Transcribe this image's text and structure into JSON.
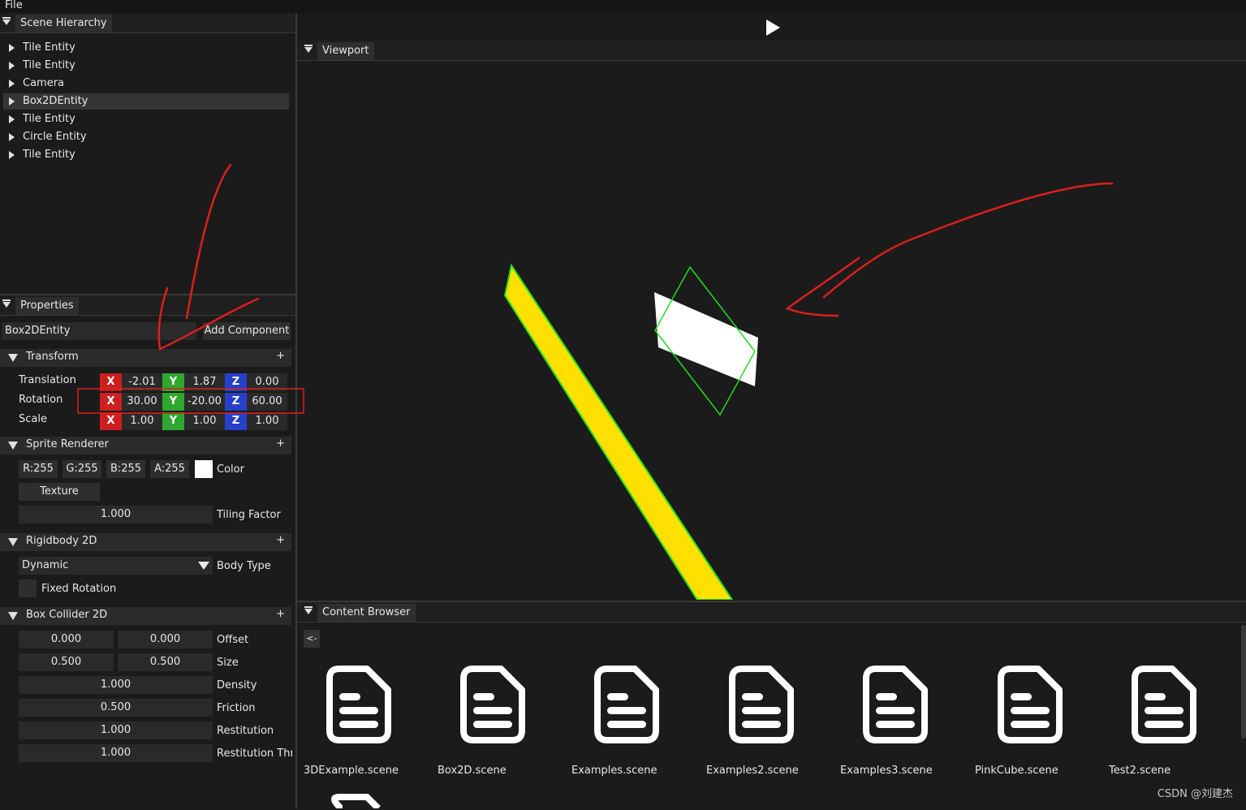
{
  "menu": {
    "file": "File"
  },
  "hierarchy": {
    "tab": "Scene Hierarchy",
    "items": [
      {
        "label": "Tile Entity"
      },
      {
        "label": "Tile Entity"
      },
      {
        "label": "Camera"
      },
      {
        "label": "Box2DEntity",
        "selected": true
      },
      {
        "label": "Tile Entity"
      },
      {
        "label": "Circle Entity"
      },
      {
        "label": "Tile Entity"
      }
    ]
  },
  "properties": {
    "tab": "Properties",
    "entity_name": "Box2DEntity",
    "add_component": "Add Component",
    "transform": {
      "title": "Transform",
      "plus": "+",
      "translation_label": "Translation",
      "rotation_label": "Rotation",
      "scale_label": "Scale",
      "axis_x": "X",
      "axis_y": "Y",
      "axis_z": "Z",
      "translation": [
        "-2.01",
        "1.87",
        "0.00"
      ],
      "rotation": [
        "30.00",
        "-20.00",
        "60.00"
      ],
      "scale": [
        "1.00",
        "1.00",
        "1.00"
      ]
    },
    "sprite": {
      "title": "Sprite Renderer",
      "plus": "+",
      "r": "R:255",
      "g": "G:255",
      "b": "B:255",
      "a": "A:255",
      "color_label": "Color",
      "color_value": "#ffffff",
      "texture": "Texture",
      "tiling": "1.000",
      "tiling_label": "Tiling Factor"
    },
    "rigidbody": {
      "title": "Rigidbody 2D",
      "plus": "+",
      "body_type": "Dynamic",
      "body_type_label": "Body Type",
      "fixed_rotation": "Fixed Rotation"
    },
    "collider": {
      "title": "Box Collider 2D",
      "plus": "+",
      "offset": [
        "0.000",
        "0.000"
      ],
      "offset_label": "Offset",
      "size": [
        "0.500",
        "0.500"
      ],
      "size_label": "Size",
      "density": "1.000",
      "density_label": "Density",
      "friction": "0.500",
      "friction_label": "Friction",
      "restitution": "1.000",
      "restitution_label": "Restitution",
      "restitution_threshold": "1.000",
      "restitution_threshold_label": "Restitution Thre"
    }
  },
  "viewport": {
    "tab": "Viewport"
  },
  "content_browser": {
    "tab": "Content Browser",
    "back": "<-",
    "files": [
      {
        "name": "3DExample.scene"
      },
      {
        "name": "Box2D.scene"
      },
      {
        "name": "Examples.scene"
      },
      {
        "name": "Examples2.scene"
      },
      {
        "name": "Examples3.scene"
      },
      {
        "name": "PinkCube.scene"
      },
      {
        "name": "Test2.scene"
      }
    ]
  },
  "watermark": "CSDN @刘建杰",
  "colors": {
    "axis_x": "#cc1f1f",
    "axis_y": "#2fa82f",
    "axis_z": "#2640c8",
    "yellow_body": "#ffe000",
    "collider_outline": "#22dd22",
    "annotation_red": "#dd1e1e"
  }
}
